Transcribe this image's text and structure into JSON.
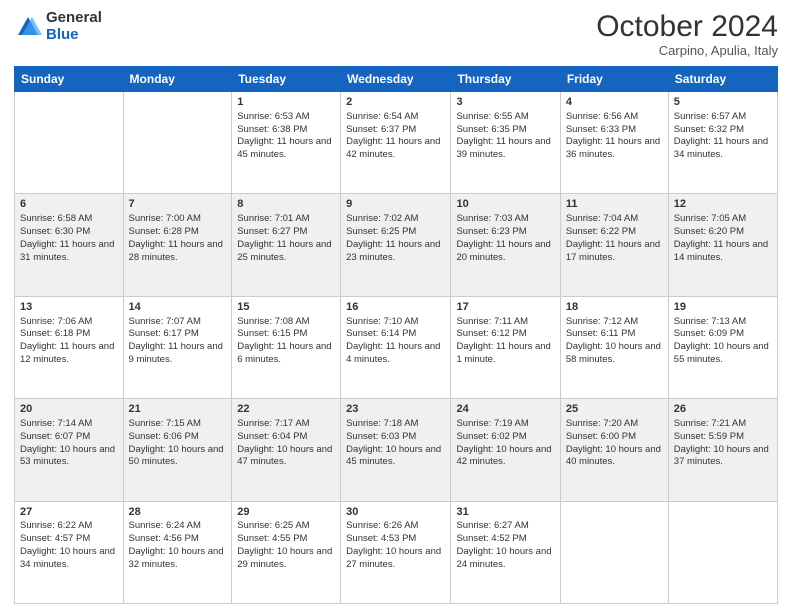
{
  "header": {
    "logo_general": "General",
    "logo_blue": "Blue",
    "month": "October 2024",
    "location": "Carpino, Apulia, Italy"
  },
  "days_of_week": [
    "Sunday",
    "Monday",
    "Tuesday",
    "Wednesday",
    "Thursday",
    "Friday",
    "Saturday"
  ],
  "weeks": [
    [
      {
        "day": "",
        "sunrise": "",
        "sunset": "",
        "daylight": ""
      },
      {
        "day": "",
        "sunrise": "",
        "sunset": "",
        "daylight": ""
      },
      {
        "day": "1",
        "sunrise": "Sunrise: 6:53 AM",
        "sunset": "Sunset: 6:38 PM",
        "daylight": "Daylight: 11 hours and 45 minutes."
      },
      {
        "day": "2",
        "sunrise": "Sunrise: 6:54 AM",
        "sunset": "Sunset: 6:37 PM",
        "daylight": "Daylight: 11 hours and 42 minutes."
      },
      {
        "day": "3",
        "sunrise": "Sunrise: 6:55 AM",
        "sunset": "Sunset: 6:35 PM",
        "daylight": "Daylight: 11 hours and 39 minutes."
      },
      {
        "day": "4",
        "sunrise": "Sunrise: 6:56 AM",
        "sunset": "Sunset: 6:33 PM",
        "daylight": "Daylight: 11 hours and 36 minutes."
      },
      {
        "day": "5",
        "sunrise": "Sunrise: 6:57 AM",
        "sunset": "Sunset: 6:32 PM",
        "daylight": "Daylight: 11 hours and 34 minutes."
      }
    ],
    [
      {
        "day": "6",
        "sunrise": "Sunrise: 6:58 AM",
        "sunset": "Sunset: 6:30 PM",
        "daylight": "Daylight: 11 hours and 31 minutes."
      },
      {
        "day": "7",
        "sunrise": "Sunrise: 7:00 AM",
        "sunset": "Sunset: 6:28 PM",
        "daylight": "Daylight: 11 hours and 28 minutes."
      },
      {
        "day": "8",
        "sunrise": "Sunrise: 7:01 AM",
        "sunset": "Sunset: 6:27 PM",
        "daylight": "Daylight: 11 hours and 25 minutes."
      },
      {
        "day": "9",
        "sunrise": "Sunrise: 7:02 AM",
        "sunset": "Sunset: 6:25 PM",
        "daylight": "Daylight: 11 hours and 23 minutes."
      },
      {
        "day": "10",
        "sunrise": "Sunrise: 7:03 AM",
        "sunset": "Sunset: 6:23 PM",
        "daylight": "Daylight: 11 hours and 20 minutes."
      },
      {
        "day": "11",
        "sunrise": "Sunrise: 7:04 AM",
        "sunset": "Sunset: 6:22 PM",
        "daylight": "Daylight: 11 hours and 17 minutes."
      },
      {
        "day": "12",
        "sunrise": "Sunrise: 7:05 AM",
        "sunset": "Sunset: 6:20 PM",
        "daylight": "Daylight: 11 hours and 14 minutes."
      }
    ],
    [
      {
        "day": "13",
        "sunrise": "Sunrise: 7:06 AM",
        "sunset": "Sunset: 6:18 PM",
        "daylight": "Daylight: 11 hours and 12 minutes."
      },
      {
        "day": "14",
        "sunrise": "Sunrise: 7:07 AM",
        "sunset": "Sunset: 6:17 PM",
        "daylight": "Daylight: 11 hours and 9 minutes."
      },
      {
        "day": "15",
        "sunrise": "Sunrise: 7:08 AM",
        "sunset": "Sunset: 6:15 PM",
        "daylight": "Daylight: 11 hours and 6 minutes."
      },
      {
        "day": "16",
        "sunrise": "Sunrise: 7:10 AM",
        "sunset": "Sunset: 6:14 PM",
        "daylight": "Daylight: 11 hours and 4 minutes."
      },
      {
        "day": "17",
        "sunrise": "Sunrise: 7:11 AM",
        "sunset": "Sunset: 6:12 PM",
        "daylight": "Daylight: 11 hours and 1 minute."
      },
      {
        "day": "18",
        "sunrise": "Sunrise: 7:12 AM",
        "sunset": "Sunset: 6:11 PM",
        "daylight": "Daylight: 10 hours and 58 minutes."
      },
      {
        "day": "19",
        "sunrise": "Sunrise: 7:13 AM",
        "sunset": "Sunset: 6:09 PM",
        "daylight": "Daylight: 10 hours and 55 minutes."
      }
    ],
    [
      {
        "day": "20",
        "sunrise": "Sunrise: 7:14 AM",
        "sunset": "Sunset: 6:07 PM",
        "daylight": "Daylight: 10 hours and 53 minutes."
      },
      {
        "day": "21",
        "sunrise": "Sunrise: 7:15 AM",
        "sunset": "Sunset: 6:06 PM",
        "daylight": "Daylight: 10 hours and 50 minutes."
      },
      {
        "day": "22",
        "sunrise": "Sunrise: 7:17 AM",
        "sunset": "Sunset: 6:04 PM",
        "daylight": "Daylight: 10 hours and 47 minutes."
      },
      {
        "day": "23",
        "sunrise": "Sunrise: 7:18 AM",
        "sunset": "Sunset: 6:03 PM",
        "daylight": "Daylight: 10 hours and 45 minutes."
      },
      {
        "day": "24",
        "sunrise": "Sunrise: 7:19 AM",
        "sunset": "Sunset: 6:02 PM",
        "daylight": "Daylight: 10 hours and 42 minutes."
      },
      {
        "day": "25",
        "sunrise": "Sunrise: 7:20 AM",
        "sunset": "Sunset: 6:00 PM",
        "daylight": "Daylight: 10 hours and 40 minutes."
      },
      {
        "day": "26",
        "sunrise": "Sunrise: 7:21 AM",
        "sunset": "Sunset: 5:59 PM",
        "daylight": "Daylight: 10 hours and 37 minutes."
      }
    ],
    [
      {
        "day": "27",
        "sunrise": "Sunrise: 6:22 AM",
        "sunset": "Sunset: 4:57 PM",
        "daylight": "Daylight: 10 hours and 34 minutes."
      },
      {
        "day": "28",
        "sunrise": "Sunrise: 6:24 AM",
        "sunset": "Sunset: 4:56 PM",
        "daylight": "Daylight: 10 hours and 32 minutes."
      },
      {
        "day": "29",
        "sunrise": "Sunrise: 6:25 AM",
        "sunset": "Sunset: 4:55 PM",
        "daylight": "Daylight: 10 hours and 29 minutes."
      },
      {
        "day": "30",
        "sunrise": "Sunrise: 6:26 AM",
        "sunset": "Sunset: 4:53 PM",
        "daylight": "Daylight: 10 hours and 27 minutes."
      },
      {
        "day": "31",
        "sunrise": "Sunrise: 6:27 AM",
        "sunset": "Sunset: 4:52 PM",
        "daylight": "Daylight: 10 hours and 24 minutes."
      },
      {
        "day": "",
        "sunrise": "",
        "sunset": "",
        "daylight": ""
      },
      {
        "day": "",
        "sunrise": "",
        "sunset": "",
        "daylight": ""
      }
    ]
  ]
}
